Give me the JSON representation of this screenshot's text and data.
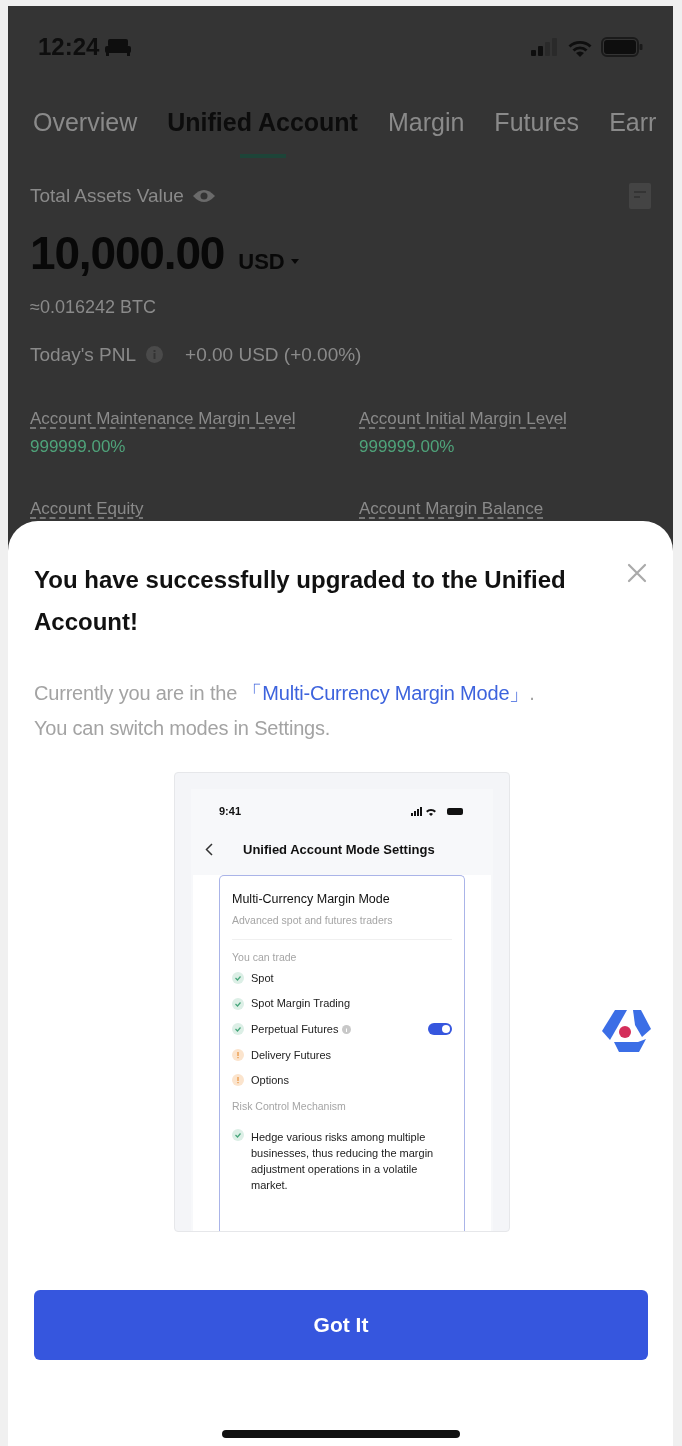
{
  "status_bar": {
    "time": "12:24"
  },
  "tabs": [
    {
      "label": "Overview",
      "selected": false
    },
    {
      "label": "Unified Account",
      "selected": true
    },
    {
      "label": "Margin",
      "selected": false
    },
    {
      "label": "Futures",
      "selected": false
    },
    {
      "label": "Earr",
      "selected": false
    }
  ],
  "assets": {
    "label": "Total Assets Value",
    "value": "10,000.00",
    "currency": "USD",
    "btc_equivalent": "≈0.016242 BTC",
    "pnl_label": "Today's PNL",
    "pnl_value": "+0.00 USD (+0.00%)"
  },
  "metrics": [
    {
      "label": "Account Maintenance Margin Level",
      "value": "999999.00%"
    },
    {
      "label": "Account Initial Margin Level",
      "value": "999999.00%"
    },
    {
      "label": "Account Equity"
    },
    {
      "label": "Account Margin Balance"
    }
  ],
  "dialog": {
    "title": "You have successfully upgraded to the Unified Account!",
    "message": {
      "before": "Currently you are in the ",
      "link": "「Multi-Currency Margin Mode」",
      "after": ". You can switch modes in Settings."
    },
    "illustration": {
      "time": "9:41",
      "screen_title": "Unified Account Mode Settings",
      "mode_title": "Multi-Currency Margin Mode",
      "mode_subtitle": "Advanced spot and futures traders",
      "trade_label": "You can trade",
      "trade_items": [
        {
          "label": "Spot",
          "kind": "check",
          "has_info": false
        },
        {
          "label": "Spot Margin Trading",
          "kind": "check",
          "has_info": false
        },
        {
          "label": "Perpetual Futures",
          "kind": "check",
          "has_info": true,
          "switch": {
            "on": true
          }
        },
        {
          "label": "Delivery Futures",
          "kind": "warning",
          "has_info": false
        },
        {
          "label": "Options",
          "kind": "warning",
          "has_info": false
        }
      ],
      "risk_label": "Risk Control Mechanism",
      "risk_items": [
        {
          "text": "Hedge various risks among multiple businesses, thus reducing the margin adjustment operations in a volatile market.",
          "kind": "check"
        }
      ]
    },
    "button": "Got It"
  }
}
